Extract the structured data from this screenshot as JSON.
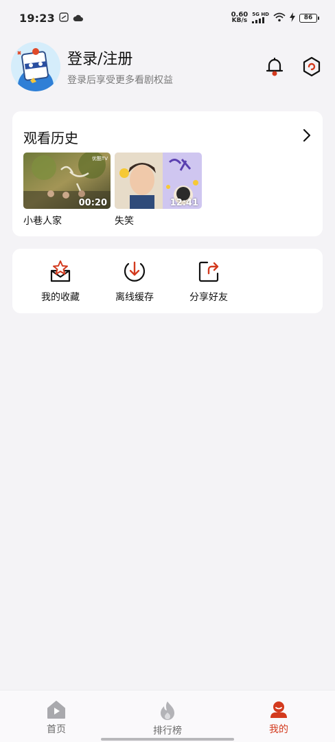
{
  "status_bar": {
    "time": "19:23",
    "net_speed": "0.60",
    "net_unit": "KB/s",
    "signal_label": "5G HD",
    "battery": "86"
  },
  "profile": {
    "title": "登录/注册",
    "subtitle": "登录后享受更多看剧权益",
    "bell_icon": "bell-icon",
    "settings_icon": "settings-icon"
  },
  "history": {
    "title": "观看历史",
    "items": [
      {
        "title": "小巷人家",
        "duration": "00:20",
        "badge": "优酷TV"
      },
      {
        "title": "失笑",
        "duration": "12:41"
      }
    ]
  },
  "shortcuts": [
    {
      "label": "我的收藏",
      "icon": "star-box-icon"
    },
    {
      "label": "离线缓存",
      "icon": "download-icon"
    },
    {
      "label": "分享好友",
      "icon": "share-icon"
    }
  ],
  "bottom_nav": {
    "tabs": [
      {
        "label": "首页",
        "icon": "home-icon"
      },
      {
        "label": "排行榜",
        "icon": "flame-icon"
      },
      {
        "label": "我的",
        "icon": "profile-icon"
      }
    ],
    "active": "我的"
  },
  "colors": {
    "accent": "#d33a1e",
    "background": "#f4f3f6",
    "card": "#ffffff"
  }
}
